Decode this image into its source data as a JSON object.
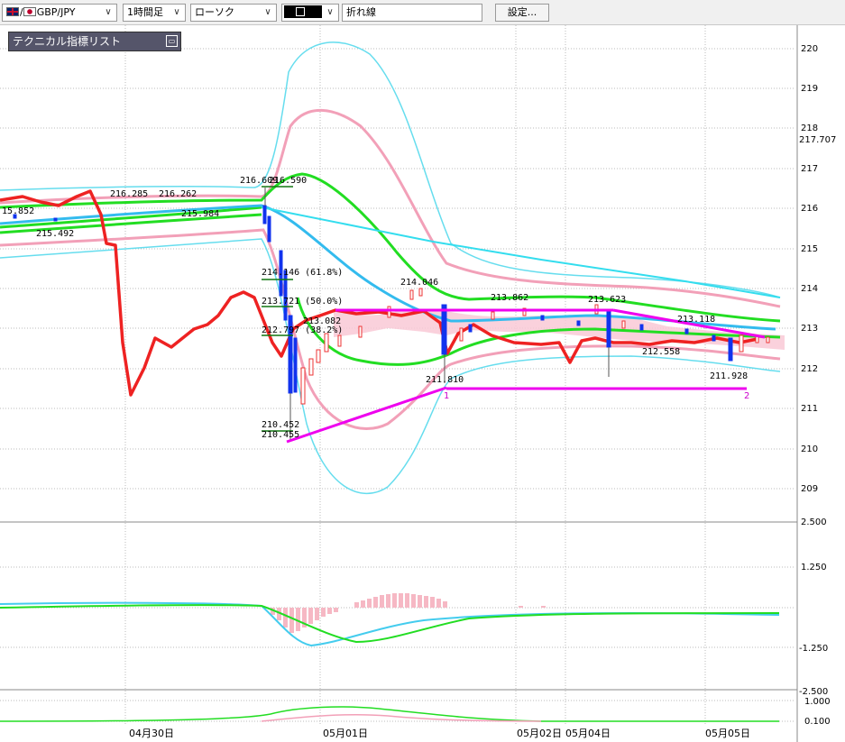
{
  "toolbar": {
    "pair_label": "GBP/JPY",
    "timeframe_label": "1時間足",
    "chart_type_label": "ローソク",
    "indicator_label": "折れ線",
    "settings_button": "設定..."
  },
  "indicator_list": {
    "title": "テクニカル指標リスト",
    "close_icon": "window-icon"
  },
  "price_axis": {
    "ticks": [
      "220",
      "219",
      "218",
      "217.707",
      "217",
      "216",
      "215",
      "214",
      "213",
      "212",
      "211",
      "210",
      "209"
    ]
  },
  "macd_axis": {
    "ticks": [
      "2.500",
      "1.250",
      "-1.250",
      "-2.500"
    ]
  },
  "lower_axis": {
    "ticks": [
      "1.000",
      "0.100"
    ]
  },
  "time_axis": {
    "labels": [
      "04月30日",
      "05月01日",
      "05月02日",
      "05月04日",
      "05月05日"
    ]
  },
  "annotations": {
    "price_labels": [
      "15.852",
      "215.492",
      "216.285",
      "216.262",
      "215.984",
      "216.609",
      "216.590",
      "213.082",
      "214.046",
      "211.810",
      "213.862",
      "213.623",
      "213.118",
      "212.558",
      "211.928",
      "210.452",
      "210.455"
    ],
    "fib_labels": [
      "214.146 (61.8%)",
      "213.721 (50.0%)",
      "212.797 (38.2%)"
    ],
    "fib_short": [
      "214.146",
      "213.721",
      "212.797"
    ],
    "fib_pct": [
      "(61.8%)",
      "(50.0%)",
      "(38.2%)"
    ],
    "markers": [
      "1",
      "2"
    ]
  },
  "colors": {
    "accent_magenta": "#ee00ee",
    "rsi_line": "#ee2222",
    "green_band": "#22dd22",
    "pink_band": "#f2a0b8",
    "cyan_band": "#66ddee",
    "sma_blue": "#33bbee",
    "candle_up": "#ee3333",
    "candle_down": "#1133ee"
  }
}
